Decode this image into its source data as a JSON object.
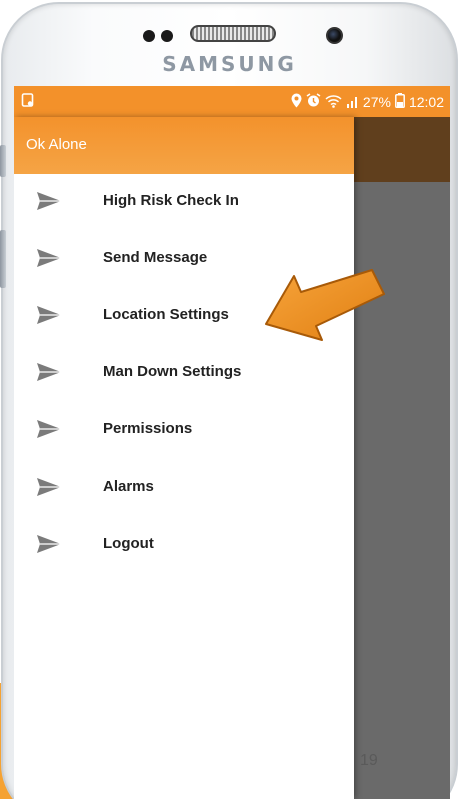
{
  "device": {
    "brand": "SAMSUNG"
  },
  "status_bar": {
    "left_icon": "notification-icon",
    "right_icons": [
      "location-icon",
      "alarm-icon",
      "wifi-icon",
      "signal-icon",
      "battery-icon"
    ],
    "battery_percent": "27%",
    "time": "12:02"
  },
  "drawer": {
    "title": "Ok Alone",
    "items": [
      {
        "label": "High Risk Check In",
        "icon": "send-icon"
      },
      {
        "label": "Send Message",
        "icon": "send-icon"
      },
      {
        "label": "Location Settings",
        "icon": "send-icon"
      },
      {
        "label": "Man Down Settings",
        "icon": "send-icon"
      },
      {
        "label": "Permissions",
        "icon": "send-icon"
      },
      {
        "label": "Alarms",
        "icon": "send-icon"
      },
      {
        "label": "Logout",
        "icon": "send-icon"
      }
    ]
  },
  "background": {
    "partial_text": "19"
  },
  "annotation": {
    "icon": "pointer-arrow-icon",
    "color": "#f0911f"
  },
  "colors": {
    "accent": "#f3912a",
    "app_bar_dark": "#603f1d",
    "scrim": "#6a6a6a"
  }
}
